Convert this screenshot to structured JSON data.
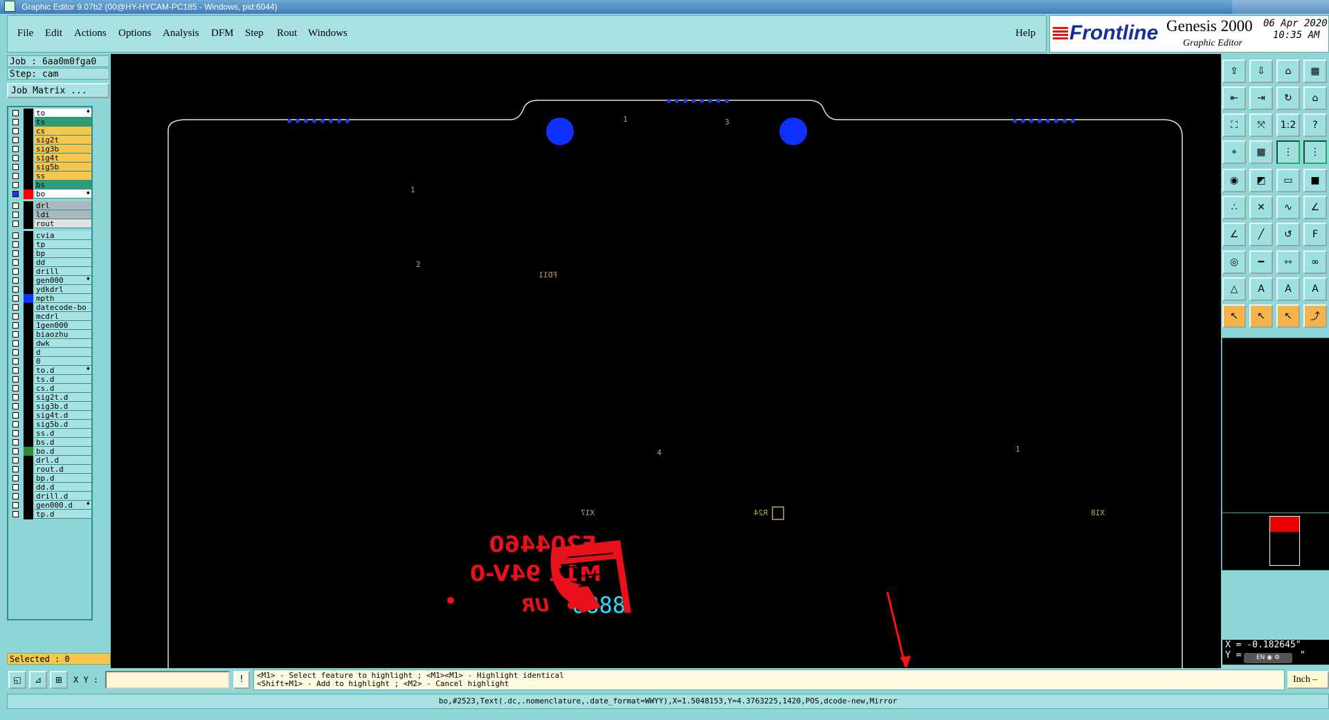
{
  "window": {
    "title": "Graphic Editor 9.07b2 (00@HY-HYCAM-PC185 - Windows, pid:6044)"
  },
  "menu": {
    "items": [
      {
        "label": "File"
      },
      {
        "label": "Edit"
      },
      {
        "label": "Actions"
      },
      {
        "label": "Options"
      },
      {
        "label": "Analysis"
      },
      {
        "label": "DFM"
      },
      {
        "label": "Step"
      },
      {
        "label": "Rout"
      },
      {
        "label": "Windows"
      }
    ],
    "help": "Help"
  },
  "brand": {
    "logo": "Frontline",
    "product": "Genesis 2000",
    "subtitle": "Graphic Editor",
    "date": "06 Apr 2020",
    "time": "10:35 AM"
  },
  "left": {
    "job": "Job : 6aa0m0fga0",
    "step": "Step: cam",
    "job_matrix_button": "Job Matrix ...",
    "selected": "Selected : 0"
  },
  "layers": [
    {
      "name": "to",
      "bg": "#ffffff",
      "swatch": "#000000",
      "mark": "♦"
    },
    {
      "name": "ts",
      "bg": "#2e9c74",
      "swatch": "#000000"
    },
    {
      "name": "cs",
      "bg": "#f5c84d",
      "swatch": "#000000"
    },
    {
      "name": "sig2t",
      "bg": "#f5c84d",
      "swatch": "#000000"
    },
    {
      "name": "sig3b",
      "bg": "#f5c84d",
      "swatch": "#000000"
    },
    {
      "name": "sig4t",
      "bg": "#f5c84d",
      "swatch": "#000000"
    },
    {
      "name": "sig5b",
      "bg": "#f5c84d",
      "swatch": "#000000"
    },
    {
      "name": "ss",
      "bg": "#f5c84d",
      "swatch": "#000000"
    },
    {
      "name": "bs",
      "bg": "#2e9c74",
      "swatch": "#000000"
    },
    {
      "name": "bo",
      "bg": "#ffffff",
      "swatch": "#ff0000",
      "mark": "▪",
      "checked": true
    },
    {
      "name": "drl",
      "bg": "#aab8c2",
      "swatch": "#000000"
    },
    {
      "name": "ldi",
      "bg": "#aab8c2",
      "swatch": "#000000"
    },
    {
      "name": "rout",
      "bg": "#e0e0e0",
      "swatch": "#000000"
    },
    {
      "name": "cvia",
      "bg": "#a8e2e2",
      "swatch": "#000000"
    },
    {
      "name": "tp",
      "bg": "#a8e2e2",
      "swatch": "#000000"
    },
    {
      "name": "bp",
      "bg": "#a8e2e2",
      "swatch": "#000000"
    },
    {
      "name": "dd",
      "bg": "#a8e2e2",
      "swatch": "#000000"
    },
    {
      "name": "drill",
      "bg": "#a8e2e2",
      "swatch": "#000000"
    },
    {
      "name": "gen000",
      "bg": "#a8e2e2",
      "swatch": "#000000",
      "mark": "♦"
    },
    {
      "name": "ydkdrl",
      "bg": "#a8e2e2",
      "swatch": "#000000"
    },
    {
      "name": "mpth",
      "bg": "#a8e2e2",
      "swatch": "#1030ff"
    },
    {
      "name": "datecode-bo",
      "bg": "#a8e2e2",
      "swatch": "#000000"
    },
    {
      "name": "mcdrl",
      "bg": "#a8e2e2",
      "swatch": "#000000"
    },
    {
      "name": "1gen000",
      "bg": "#a8e2e2",
      "swatch": "#000000"
    },
    {
      "name": "biaozhu",
      "bg": "#a8e2e2",
      "swatch": "#000000"
    },
    {
      "name": "dwk",
      "bg": "#a8e2e2",
      "swatch": "#000000"
    },
    {
      "name": "d",
      "bg": "#a8e2e2",
      "swatch": "#000000"
    },
    {
      "name": "0",
      "bg": "#a8e2e2",
      "swatch": "#000000"
    },
    {
      "name": "to.d",
      "bg": "#a8e2e2",
      "swatch": "#000000",
      "mark": "♦"
    },
    {
      "name": "ts.d",
      "bg": "#a8e2e2",
      "swatch": "#000000"
    },
    {
      "name": "cs.d",
      "bg": "#a8e2e2",
      "swatch": "#000000"
    },
    {
      "name": "sig2t.d",
      "bg": "#a8e2e2",
      "swatch": "#000000"
    },
    {
      "name": "sig3b.d",
      "bg": "#a8e2e2",
      "swatch": "#000000"
    },
    {
      "name": "sig4t.d",
      "bg": "#a8e2e2",
      "swatch": "#000000"
    },
    {
      "name": "sig5b.d",
      "bg": "#a8e2e2",
      "swatch": "#000000"
    },
    {
      "name": "ss.d",
      "bg": "#a8e2e2",
      "swatch": "#000000"
    },
    {
      "name": "bs.d",
      "bg": "#a8e2e2",
      "swatch": "#000000"
    },
    {
      "name": "bo.d",
      "bg": "#a8e2e2",
      "swatch": "#2e8b2e"
    },
    {
      "name": "drl.d",
      "bg": "#a8e2e2",
      "swatch": "#000000"
    },
    {
      "name": "rout.d",
      "bg": "#a8e2e2",
      "swatch": "#000000"
    },
    {
      "name": "bp.d",
      "bg": "#a8e2e2",
      "swatch": "#000000"
    },
    {
      "name": "dd.d",
      "bg": "#a8e2e2",
      "swatch": "#000000"
    },
    {
      "name": "drill.d",
      "bg": "#a8e2e2",
      "swatch": "#000000"
    },
    {
      "name": "gen000.d",
      "bg": "#a8e2e2",
      "swatch": "#000000",
      "mark": "♦"
    },
    {
      "name": "tp.d",
      "bg": "#a8e2e2",
      "swatch": "#000000"
    }
  ],
  "canvas_labels": {
    "l1": "1",
    "l3": "3",
    "l1b": "1",
    "l2": "2",
    "fd11": "FD11",
    "l4": "4",
    "l1c": "1",
    "x17": "X17",
    "r24": "R24",
    "x18": "X18"
  },
  "logo_mark": {
    "line1": "E204460",
    "line2": "M11 94V-0",
    "ur": "UR",
    "code": "8888"
  },
  "tool_icons": [
    "open-job-icon",
    "save-icon",
    "home-icon",
    "panel-icon",
    "zoom-back-icon",
    "zoom-forward-icon",
    "redo-icon",
    "zoom-home-icon",
    "fit-icon",
    "zoom-all-icon",
    "scale-1-2-icon",
    "help-icon",
    "snap-icon",
    "grid-icon",
    "layers-active-icon",
    "measure-active-icon",
    "record-icon",
    "profile-icon",
    "ruler-icon",
    "pad-icon",
    "net-icon",
    "cross-icon",
    "connect-icon",
    "drag-icon",
    "line-angle-icon",
    "line-icon",
    "arc-icon",
    "text-f-icon",
    "pad-select-icon",
    "split-icon",
    "move-icon",
    "group-icon",
    "triangle-icon",
    "triangle-a-icon",
    "triangle-b-icon",
    "triangle-c-icon",
    "pointer-icon",
    "pointer-alt-icon",
    "pointer-box-icon",
    "route-icon"
  ],
  "right": {
    "x": "X = -0.182645\"",
    "y": "Y =",
    "y_tail": "\"",
    "ime": "EN"
  },
  "command": {
    "xy_label": "X Y :",
    "xy_value": "",
    "bang": "!",
    "hint_line1": "<M1> - Select feature to highlight ; <M1><M1> - Highlight identical",
    "hint_line2": "<Shift+M1> - Add to highlight ; <M2> - Cancel highlight",
    "units": "Inch"
  },
  "status": "bo,#2523,Text(.dc,.nomenclature,.date_format=WWYY),X=1.5048153,Y=4.3763225,1420,POS,dcode-new,Mirror"
}
